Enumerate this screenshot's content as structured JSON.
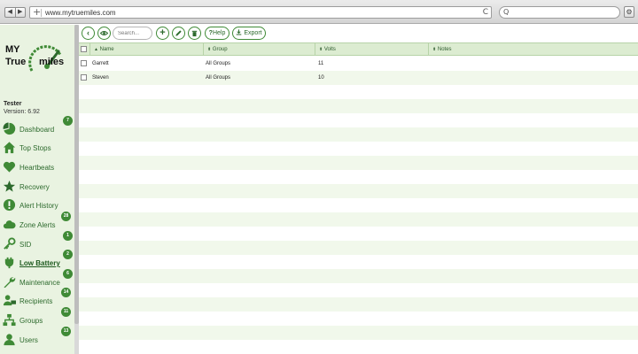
{
  "browser": {
    "url": "www.mytruemiles.com",
    "back": "◀",
    "forward": "▶",
    "plus": "+",
    "reload": "C",
    "search_icon": "Q",
    "gear": "⚙"
  },
  "logo": {
    "line1": "MY",
    "line2": "True",
    "line3": "miles"
  },
  "user": {
    "name": "Tester",
    "version": "Version: 6.92"
  },
  "menu": [
    {
      "label": "Dashboard",
      "icon": "pie-chart-icon",
      "badge": "7"
    },
    {
      "label": "Top Stops",
      "icon": "home-icon",
      "badge": ""
    },
    {
      "label": "Heartbeats",
      "icon": "heart-icon",
      "badge": ""
    },
    {
      "label": "Recovery",
      "icon": "star-icon",
      "badge": ""
    },
    {
      "label": "Alert History",
      "icon": "alert-icon",
      "badge": ""
    },
    {
      "label": "Zone Alerts",
      "icon": "cloud-icon",
      "badge": "28"
    },
    {
      "label": "SID",
      "icon": "key-icon",
      "badge": "1"
    },
    {
      "label": "Low Battery",
      "icon": "plug-icon",
      "badge": "2",
      "active": true
    },
    {
      "label": "Maintenance",
      "icon": "wrench-icon",
      "badge": "6"
    },
    {
      "label": "Recipients",
      "icon": "recipients-icon",
      "badge": "14"
    },
    {
      "label": "Groups",
      "icon": "groups-icon",
      "badge": "11"
    },
    {
      "label": "Users",
      "icon": "user-icon",
      "badge": "13"
    }
  ],
  "toolbar": {
    "back_icon": "‹",
    "search_placeholder": "Search...",
    "add_icon": "+",
    "help_label": "Help",
    "help_prefix": "?",
    "export_label": "Export"
  },
  "table": {
    "columns": [
      "Name",
      "Group",
      "Volts",
      "Notes"
    ],
    "sort_asc": "▲",
    "sort_both": "⬍",
    "rows": [
      {
        "name": "Garrett",
        "group": "All Groups",
        "volts": "11",
        "notes": ""
      },
      {
        "name": "Steven",
        "group": "All Groups",
        "volts": "10",
        "notes": ""
      }
    ]
  },
  "colors": {
    "accent": "#3f8a36",
    "sidebar_bg": "#e9f3e1",
    "header_bg": "#dcecd1",
    "row_alt": "#f1f8eb"
  }
}
